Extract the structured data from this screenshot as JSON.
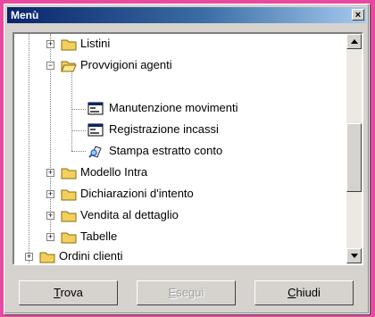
{
  "window": {
    "title": "Menù",
    "close_glyph": "×"
  },
  "tree": {
    "items": [
      {
        "label": "Listini",
        "expander": "+",
        "icon": "folder-closed-icon"
      },
      {
        "label": "Provvigioni agenti",
        "expander": "−",
        "icon": "folder-open-icon"
      },
      {
        "label": "Manutenzione movimenti",
        "icon": "form-window-icon"
      },
      {
        "label": "Registrazione incassi",
        "icon": "form-window-icon"
      },
      {
        "label": "Stampa estratto conto",
        "icon": "print-preview-icon"
      },
      {
        "label": "Modello Intra",
        "expander": "+",
        "icon": "folder-closed-icon"
      },
      {
        "label": "Dichiarazioni d'intento",
        "expander": "+",
        "icon": "folder-closed-icon"
      },
      {
        "label": "Vendita al dettaglio",
        "expander": "+",
        "icon": "folder-closed-icon"
      },
      {
        "label": "Tabelle",
        "expander": "+",
        "icon": "folder-closed-icon"
      },
      {
        "label": "Ordini clienti",
        "expander": "+",
        "icon": "folder-closed-icon"
      }
    ]
  },
  "buttons": {
    "trova": {
      "first": "T",
      "rest": "rova"
    },
    "esegui": {
      "first": "E",
      "rest": "segui"
    },
    "chiudi": {
      "first": "C",
      "rest": "hiudi"
    }
  },
  "colors": {
    "folder": "#f2d05a",
    "background": "#e74aa0",
    "titlebar": "#0a246a"
  }
}
